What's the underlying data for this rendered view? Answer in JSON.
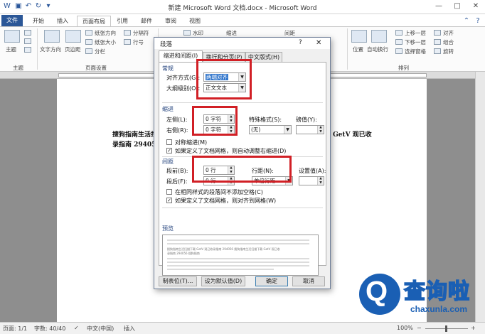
{
  "window": {
    "title": "新建 Microsoft Word 文档.docx - Microsoft Word",
    "minimize": "—",
    "maximize": "□",
    "close": "✕"
  },
  "tabs": [
    "文件",
    "开始",
    "插入",
    "页面布局",
    "引用",
    "邮件",
    "审阅",
    "视图"
  ],
  "ribbon": {
    "theme_label": "主题",
    "text_direction": "文字方向",
    "margins": "页边距",
    "orientation": "纸张方向",
    "size": "纸张大小",
    "columns": "分栏",
    "breaks": "分隔符",
    "line_numbers": "行号",
    "watermark": "水印",
    "indent": "缩进",
    "spacing": "间距",
    "position": "位置",
    "wrap_text": "自动换行",
    "bring_forward": "上移一层",
    "send_backward": "下移一层",
    "selection_pane": "选择窗格",
    "align": "对齐",
    "group": "组合",
    "rotate": "旋转",
    "group_themes": "主题",
    "group_page_setup": "页面设置",
    "group_arrange": "排列"
  },
  "document": {
    "line1_left": "搜狗指南生活扫",
    "line1_right": "GetV  观已收",
    "line2": "录指南 294056"
  },
  "status": {
    "page": "页面: 1/1",
    "words": "字数: 40/40",
    "language": "中文(中国)",
    "insert_mode": "插入",
    "zoom": "100%"
  },
  "dialog": {
    "title": "段落",
    "help": "?",
    "close": "✕",
    "tabs": [
      "缩进和间距(I)",
      "换行和分页(P)",
      "中文版式(H)"
    ],
    "general": {
      "section": "常规",
      "alignment_label": "对齐方式(G):",
      "alignment_value": "两端对齐",
      "outline_label": "大纲级别(O):",
      "outline_value": "正文文本"
    },
    "indentation": {
      "section": "缩进",
      "left_label": "左侧(L):",
      "left_value": "0 字符",
      "right_label": "右侧(R):",
      "right_value": "0 字符",
      "special_label": "特殊格式(S):",
      "special_value": "(无)",
      "by_label": "磅值(Y):",
      "mirror": "对称缩进(M)",
      "auto_adjust": "如果定义了文档网格，则自动调整右缩进(D)"
    },
    "spacing": {
      "section": "间距",
      "before_label": "段前(B):",
      "before_value": "0 行",
      "after_label": "段后(F):",
      "after_value": "0 行",
      "line_label": "行距(N):",
      "line_value": "单倍行距",
      "at_label": "设置值(A):",
      "dont_add": "在相同样式的段落间不添加空格(C)",
      "snap_grid": "如果定义了文档网格，则对齐到网格(W)"
    },
    "preview": {
      "section": "预览",
      "sample1": "搜狗指南生活扫描下载 GetV 观已收录指南 294056 搜狗指南生活扫描下载 GetV 观已收",
      "sample2": "录指南 294056 搜狗指南"
    },
    "buttons": {
      "tabs": "制表位(T)...",
      "set_default": "设为默认值(D)",
      "ok": "确定",
      "cancel": "取消"
    }
  },
  "watermark": {
    "cn": "查询啦",
    "en": "chaxunla.com",
    "logo_letter": "Q"
  }
}
